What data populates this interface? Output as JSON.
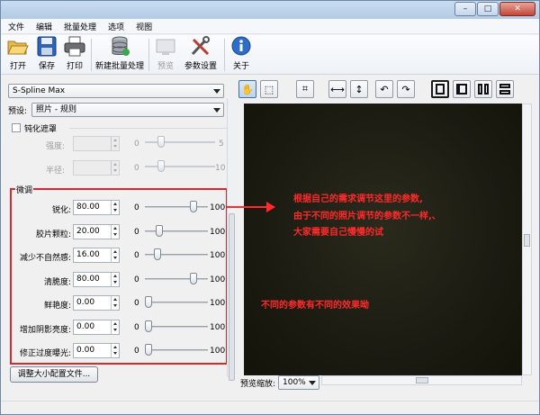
{
  "colors": {
    "accent": "#e0262a",
    "annotation": "#ff2a2a",
    "preview_bg": "#1b1b12"
  },
  "window": {
    "min_glyph": "–",
    "max_glyph": "□",
    "close_glyph": "✕"
  },
  "menu": [
    "文件",
    "编辑",
    "批量处理",
    "选项",
    "视图"
  ],
  "toolbar": {
    "open": "打开",
    "save": "保存",
    "print": "打印",
    "new_batch": "新建批量处理",
    "preview": "预览",
    "settings": "参数设置",
    "about": "关于"
  },
  "left": {
    "method": "S-Spline Max",
    "preset_label": "预设:",
    "preset_value": "照片 - 规则",
    "unsharp_mask": {
      "label": "钝化遮罩",
      "strength": {
        "label": "强度:",
        "min": "0",
        "max": "5",
        "value": 0.2
      },
      "radius": {
        "label": "半径:",
        "min": "0",
        "max": "10",
        "value": 0.2
      }
    },
    "group_title": "微调",
    "fine_tune": [
      {
        "label": "锐化:",
        "value": "80.00",
        "min": "0",
        "max": "100",
        "level": 0.8
      },
      {
        "label": "胶片颗粒:",
        "value": "20.00",
        "min": "0",
        "max": "100",
        "level": 0.2
      },
      {
        "label": "减少不自然感:",
        "value": "16.00",
        "min": "0",
        "max": "100",
        "level": 0.16
      },
      {
        "label": "清脆度:",
        "value": "80.00",
        "min": "0",
        "max": "100",
        "level": 0.8
      },
      {
        "label": "鲜艳度:",
        "value": "0.00",
        "min": "0",
        "max": "100",
        "level": 0
      },
      {
        "label": "增加阴影亮度:",
        "value": "0.00",
        "min": "0",
        "max": "100",
        "level": 0
      },
      {
        "label": "修正过度曝光:",
        "value": "0.00",
        "min": "0",
        "max": "100",
        "level": 0
      }
    ],
    "resize_button": "调整大小配置文件..."
  },
  "view": {
    "hand_glyph": "✋",
    "select_glyph": "⬚",
    "crop_glyph": "⌗",
    "fit_width_glyph": "⟷",
    "fit_height_glyph": "↕",
    "rotate_left_glyph": "↶",
    "rotate_right_glyph": "↷",
    "zoom_label": "预览缩放:",
    "zoom_value": "100%"
  },
  "annotations": {
    "line1": "根据自己的需求调节这里的参数,",
    "line2": "由于不同的照片调节的参数不一样,、",
    "line3": "大家需要自己慢慢的试",
    "note2": "不同的参数有不同的效果呦"
  }
}
